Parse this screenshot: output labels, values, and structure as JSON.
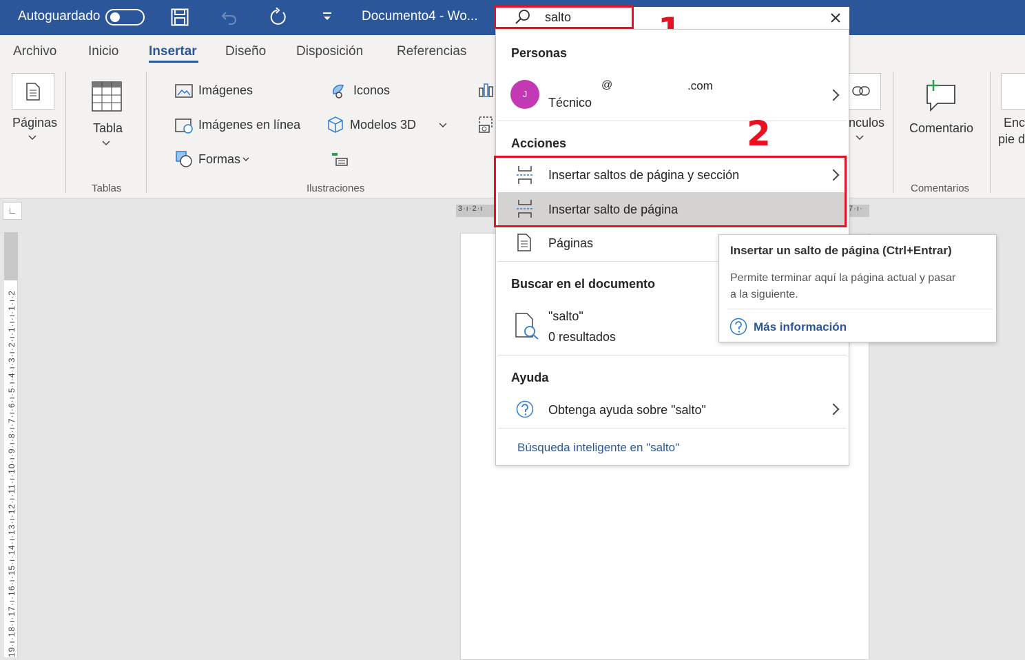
{
  "titlebar": {
    "autosave_label": "Autoguardado",
    "doc_title": "Documento4  -  Wo..."
  },
  "search": {
    "query": "salto"
  },
  "tabs": [
    "Archivo",
    "Inicio",
    "Insertar",
    "Diseño",
    "Disposición",
    "Referencias"
  ],
  "ribbon": {
    "paginas": "Páginas",
    "tabla": "Tabla",
    "tablas_group": "Tablas",
    "imagenes": "Imágenes",
    "imagenes_linea": "Imágenes en línea",
    "formas": "Formas",
    "iconos": "Iconos",
    "modelos3d": "Modelos 3D",
    "ilustraciones_group": "Ilustraciones",
    "vinculos_partial": "nculos",
    "comentario": "Comentario",
    "comentarios_group": "Comentarios",
    "encabezado_partial_1": "Enca",
    "encabezado_partial_2": "pie d"
  },
  "dropdown": {
    "personas_header": "Personas",
    "person_initial": "J",
    "person_at": "@",
    "person_domain": ".com",
    "person_role": "Técnico",
    "acciones_header": "Acciones",
    "action_1": "Insertar saltos de página y sección",
    "action_2": "Insertar salto de página",
    "action_3": "Páginas",
    "buscar_header": "Buscar en el documento",
    "buscar_query": "\"salto\"",
    "buscar_results": "0 resultados",
    "ayuda_header": "Ayuda",
    "ayuda_item": "Obtenga ayuda sobre \"salto\"",
    "smart_search": "Búsqueda inteligente en \"salto\""
  },
  "tooltip": {
    "title": "Insertar un salto de página (Ctrl+Entrar)",
    "desc_line1": "Permite terminar aquí la página actual y pasar",
    "desc_line2": "a la siguiente.",
    "more": "Más información"
  },
  "annotations": {
    "step1": "1",
    "step2": "2"
  },
  "ruler": {
    "horizontal_left": "3·ı·2·ı",
    "horizontal_right": "7·ı·",
    "vertical": "19·ı·18·ı·17·ı·16·ı·15·ı·14·ı·13·ı·12·ı·11·ı·10·ı·9·ı·8·ı·7·ı·6·ı·5·ı·4·ı·3·ı·2·ı·1·ı·ı·1·ı·2"
  },
  "colors": {
    "brand": "#2b579a",
    "annotation": "#e81123",
    "avatar": "#c239b3"
  }
}
